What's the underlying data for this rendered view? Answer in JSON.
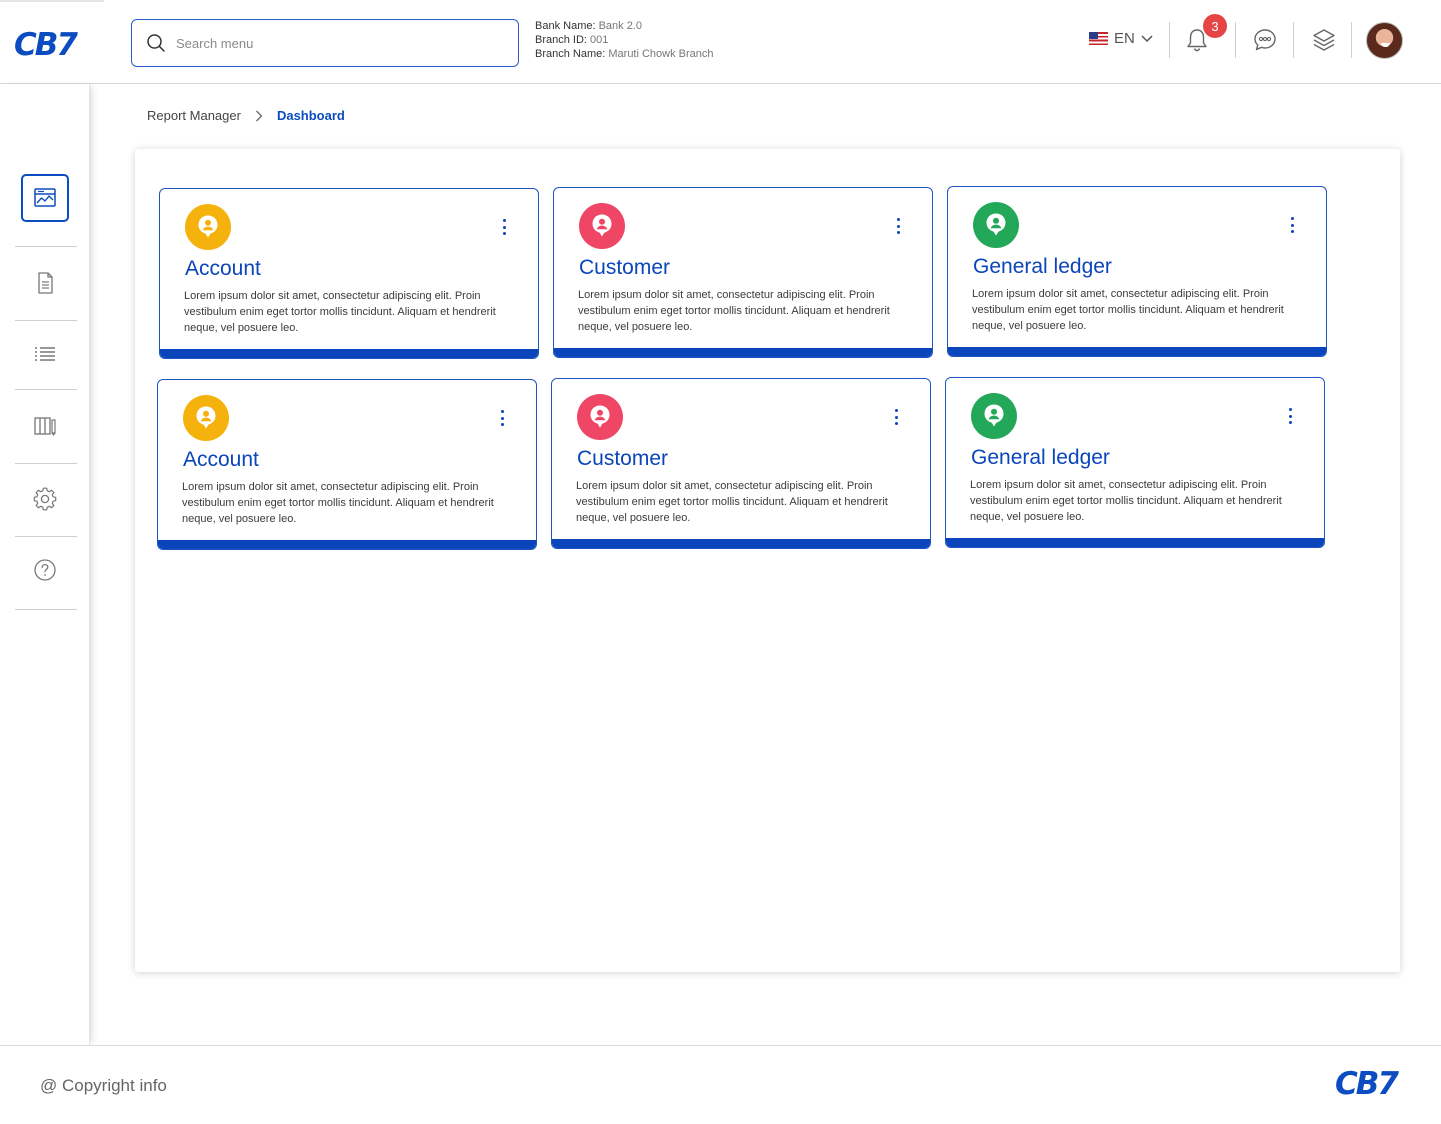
{
  "brand": {
    "logo_text": "CB7",
    "accent": "#0b4cc0"
  },
  "header": {
    "search": {
      "placeholder": "Search menu",
      "value": ""
    },
    "bank": {
      "bank_name_label": "Bank Name:",
      "bank_name_value": "Bank 2.0",
      "branch_id_label": "Branch ID:",
      "branch_id_value": "001",
      "branch_name_label": "Branch Name:",
      "branch_name_value": "Maruti Chowk Branch"
    },
    "language": {
      "flag": "us-flag-icon",
      "label": "EN"
    },
    "notifications": {
      "icon": "bell-icon",
      "count": "3"
    },
    "icons": [
      "bell-icon",
      "chat-icon",
      "layers-icon"
    ]
  },
  "sidebar": {
    "items": [
      {
        "name": "dashboard",
        "icon": "dashboard-chart-icon",
        "active": true
      },
      {
        "name": "documents",
        "icon": "document-icon",
        "active": false
      },
      {
        "name": "list",
        "icon": "list-icon",
        "active": false
      },
      {
        "name": "columns",
        "icon": "columns-edit-icon",
        "active": false
      },
      {
        "name": "settings",
        "icon": "gear-icon",
        "active": false
      },
      {
        "name": "help",
        "icon": "help-icon",
        "active": false
      }
    ]
  },
  "breadcrumb": {
    "root": "Report Manager",
    "current": "Dashboard"
  },
  "cards": [
    {
      "title": "Account",
      "color": "#f5b10c",
      "description": "Lorem ipsum dolor sit amet, consectetur adipiscing elit. Proin vestibulum enim eget tortor mollis tincidunt. Aliquam et hendrerit neque, vel posuere leo."
    },
    {
      "title": "Customer",
      "color": "#ef4665",
      "description": "Lorem ipsum dolor sit amet, consectetur adipiscing elit. Proin vestibulum enim eget tortor mollis tincidunt. Aliquam et hendrerit neque, vel posuere leo."
    },
    {
      "title": "General ledger",
      "color": "#22a858",
      "description": "Lorem ipsum dolor sit amet, consectetur adipiscing elit. Proin vestibulum enim eget tortor mollis tincidunt. Aliquam et hendrerit neque, vel posuere leo."
    },
    {
      "title": "Account",
      "color": "#f5b10c",
      "description": "Lorem ipsum dolor sit amet, consectetur adipiscing elit. Proin vestibulum enim eget tortor mollis tincidunt. Aliquam et hendrerit neque, vel posuere leo."
    },
    {
      "title": "Customer",
      "color": "#ef4665",
      "description": "Lorem ipsum dolor sit amet, consectetur adipiscing elit. Proin vestibulum enim eget tortor mollis tincidunt. Aliquam et hendrerit neque, vel posuere leo."
    },
    {
      "title": "General ledger",
      "color": "#22a858",
      "description": "Lorem ipsum dolor sit amet, consectetur adipiscing elit. Proin vestibulum enim eget tortor mollis tincidunt. Aliquam et hendrerit neque, vel posuere leo."
    }
  ],
  "footer": {
    "copyright": "@ Copyright info",
    "logo_text": "CB7"
  }
}
